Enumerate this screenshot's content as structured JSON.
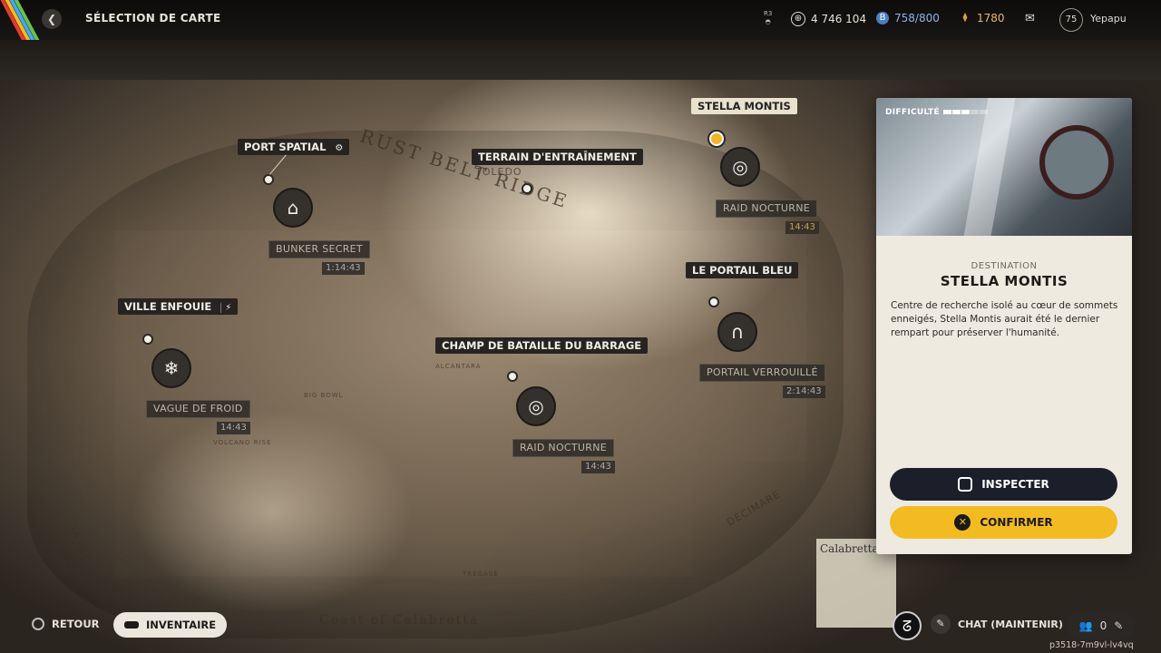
{
  "header": {
    "title": "SÉLECTION DE CARTE",
    "r3_label": "R3",
    "currencies": [
      {
        "icon": "coin-icon",
        "value": "4 746 104"
      },
      {
        "icon": "blue-token-icon",
        "value": "758/800"
      },
      {
        "icon": "resource-icon",
        "value": "1780"
      }
    ],
    "level": "75",
    "username": "Yepapu"
  },
  "map": {
    "region_labels": [
      "RUST BELT RIDGE",
      "BIG BOWL",
      "VOLCANO RISE",
      "LA CARTIERA",
      "DECIMARE",
      "TREGASE",
      "ALCANTARA",
      "Coast of Calabretta",
      "Calabretta",
      "TOLEDO"
    ],
    "locations": [
      {
        "name": "PORT SPATIAL",
        "icon": "gear-icon"
      },
      {
        "name": "TERRAIN D'ENTRAÎNEMENT"
      },
      {
        "name": "STELLA MONTIS",
        "selected": true
      },
      {
        "name": "LE PORTAIL BLEU"
      },
      {
        "name": "VILLE ENFOUIE",
        "icon": "no-signal-icon"
      },
      {
        "name": "CHAMP DE BATAILLE DU BARRAGE"
      }
    ],
    "events": [
      {
        "name": "BUNKER SECRET",
        "timer": "1:14:43",
        "icon": "bunker-icon"
      },
      {
        "name": "RAID NOCTURNE",
        "timer": "14:43",
        "icon": "night-raid-icon"
      },
      {
        "name": "PORTAIL VERROUILLÉ",
        "timer": "2:14:43",
        "icon": "locked-gate-icon"
      },
      {
        "name": "VAGUE DE FROID",
        "timer": "14:43",
        "icon": "snowflake-icon"
      },
      {
        "name": "RAID NOCTURNE",
        "timer": "14:43",
        "icon": "night-raid-icon"
      }
    ]
  },
  "panel": {
    "difficulty_label": "DIFFICULTÉ",
    "difficulty_level": 3,
    "difficulty_max": 5,
    "kicker": "DESTINATION",
    "name": "STELLA MONTIS",
    "description": "Centre de recherche isolé au cœur de sommets enneigés, Stella Montis aurait été le dernier rempart pour préserver l'humanité.",
    "inspect_label": "INSPECTER",
    "confirm_label": "CONFIRMER"
  },
  "footer": {
    "back_label": "RETOUR",
    "inventory_label": "INVENTAIRE",
    "chat_label": "CHAT (MAINTENIR)",
    "party_count": "0",
    "session_code": "p3518-7m9vl-lv4vq"
  },
  "colors": {
    "accent": "#f3bb22",
    "panel_bg": "#eeeadf",
    "dark_button": "#1c1e2a"
  }
}
